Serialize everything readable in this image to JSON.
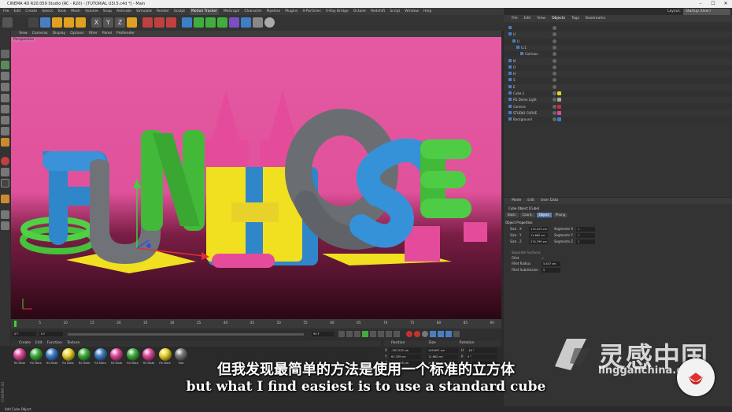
{
  "window": {
    "title": "CINEMA 4D R20.059 Studio (RC - R20) - [TUTORIAL U3l.5.c4d *] - Main",
    "minimize": "–",
    "maximize": "☐",
    "close": "✕"
  },
  "menu": [
    "File",
    "Edit",
    "Create",
    "Select",
    "Tools",
    "Mesh",
    "Volume",
    "Snap",
    "Animate",
    "Simulate",
    "Render",
    "Sculpt",
    "Motion Tracker",
    "MoGraph",
    "Character",
    "Pipeline",
    "Plugins",
    "X-Particles",
    "V-Ray Bridge",
    "Octane",
    "Redshift",
    "Script",
    "Window",
    "Help"
  ],
  "layout": {
    "label": "Layout:",
    "value": "Startup (User)"
  },
  "viewport": {
    "menu": [
      "View",
      "Cameras",
      "Display",
      "Options",
      "Filter",
      "Panel",
      "ProRender"
    ],
    "label": "Perspective",
    "grid_spacing": "Grid Spacing : 1000 cm",
    "letters": [
      "F",
      "U",
      "N",
      "H",
      "O",
      "S",
      "E"
    ]
  },
  "timeline": {
    "ticks": [
      "0",
      "5",
      "10",
      "15",
      "20",
      "25",
      "30",
      "35",
      "40",
      "45",
      "50",
      "55",
      "60",
      "65",
      "70",
      "75",
      "80",
      "85",
      "90"
    ],
    "frame_field": "0 F",
    "start_field": "0 F",
    "end_field": "90 F",
    "current_frame": "0 F"
  },
  "materials": {
    "menu": [
      "Create",
      "Edit",
      "Function",
      "Texture"
    ],
    "items": [
      {
        "label": "RS Mate",
        "color": "#e04a9a"
      },
      {
        "label": "RS Mate",
        "color": "#3fae3c"
      },
      {
        "label": "RS Mate",
        "color": "#3d7ec6"
      },
      {
        "label": "RS Mate",
        "color": "#e8d22a"
      },
      {
        "label": "RS Mate",
        "color": "#3fae3c"
      },
      {
        "label": "RS Mate",
        "color": "#3d7ec6"
      },
      {
        "label": "RS Mate",
        "color": "#e04a9a"
      },
      {
        "label": "RS Mate",
        "color": "#3fae3c"
      },
      {
        "label": "RS Mate",
        "color": "#e04a9a"
      },
      {
        "label": "RS Mate",
        "color": "#e8d22a"
      },
      {
        "label": "Mat",
        "color": "#777777"
      }
    ]
  },
  "coords": {
    "headers": [
      "Position",
      "Size",
      "Rotation"
    ],
    "rows": [
      {
        "axis": "X",
        "pos": "-187.225 cm",
        "size": "149.697 cm",
        "rot_axis": "H",
        "rot": "-18 °"
      },
      {
        "axis": "Y",
        "pos": "61.339 cm",
        "size": "11.662 cm",
        "rot_axis": "P",
        "rot": "0 °"
      },
      {
        "axis": "Z",
        "pos": "-213.906 cm",
        "size": "274.799 cm",
        "rot_axis": "B",
        "rot": "0 °"
      }
    ],
    "mode": "Object (Rel)",
    "size_mode": "Size",
    "apply": "Apply"
  },
  "objects": {
    "menu": [
      "File",
      "Edit",
      "View",
      "Objects",
      "Tags",
      "Bookmarks"
    ],
    "active_menu": "Objects",
    "rows": [
      {
        "name": "",
        "indent": 0
      },
      {
        "name": "U",
        "indent": 0
      },
      {
        "name": "U",
        "indent": 1
      },
      {
        "name": "U.1",
        "indent": 2
      },
      {
        "name": "Collision",
        "indent": 3
      },
      {
        "name": "N",
        "indent": 0
      },
      {
        "name": "O",
        "indent": 0
      },
      {
        "name": "H",
        "indent": 0
      },
      {
        "name": "S",
        "indent": 0
      },
      {
        "name": "E",
        "indent": 0
      },
      {
        "name": "Cube.1",
        "indent": 0
      },
      {
        "name": "RS Dome Light",
        "indent": 0
      },
      {
        "name": "Camera",
        "indent": 0
      },
      {
        "name": "STUDIO CURVE",
        "indent": 0
      },
      {
        "name": "Background",
        "indent": 0
      }
    ]
  },
  "attributes": {
    "menu": [
      "Mode",
      "Edit",
      "User Data"
    ],
    "object_title": "Cube Object [Cube]",
    "tabs": [
      "Basic",
      "Coord.",
      "Object",
      "Phong"
    ],
    "active_tab": "Object",
    "section": "Object Properties",
    "size_rows": [
      {
        "label": "Size . X",
        "value": "174.225 cm",
        "seg_label": "Segments X",
        "seg": "1"
      },
      {
        "label": "Size . Y",
        "value": "11.662 cm",
        "seg_label": "Segments Y",
        "seg": "1"
      },
      {
        "label": "Size . Z",
        "value": "274.799 cm",
        "seg_label": "Segments Z",
        "seg": "1"
      }
    ],
    "separate": "Separate Surfaces",
    "fillet": "Fillet",
    "fillet_check": "✓",
    "fillet_radius_label": "Fillet Radius",
    "fillet_radius": "5.837 cm",
    "fillet_sub_label": "Fillet Subdivision",
    "fillet_sub": "5"
  },
  "status": "Add Cube Object",
  "side_label": "CINEMA 4D",
  "subtitles": {
    "cn": "但我发现最简单的方法是使用一个标准的立方体",
    "en": "but what I find easiest is to use a standard cube"
  },
  "watermark": {
    "cn": "灵感中国",
    "en": "lingganchina.com"
  },
  "colors": {
    "background_pink": "#e2569f",
    "floor": "#3a0a1c",
    "blue": "#2f86c9",
    "green": "#43b93a",
    "yellow": "#f0e020",
    "pink": "#e54b9b",
    "grey": "#6f7378",
    "accent": "#4a7ec2"
  }
}
